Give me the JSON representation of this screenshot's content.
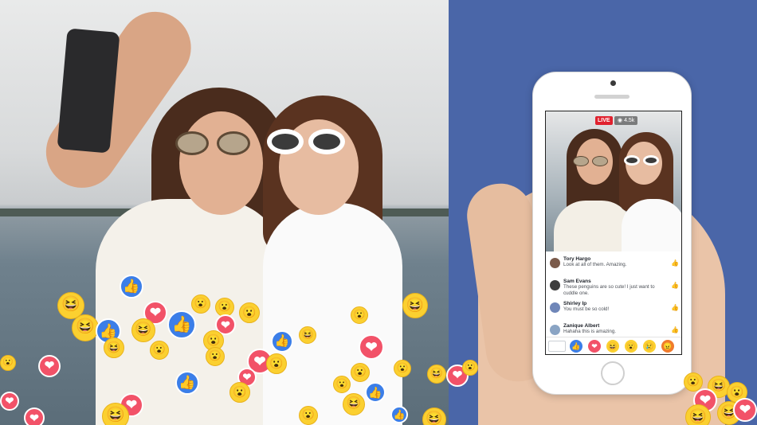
{
  "colors": {
    "brand_blue": "#4a66a8",
    "like_blue": "#3b7ee8",
    "love_red": "#f25268",
    "emoji_yellow": "#fbd030",
    "live_red": "#e0212e"
  },
  "live": {
    "badge": "LIVE",
    "viewer_icon": "eye-icon",
    "viewer_count": "4.5k"
  },
  "comments": [
    {
      "name": "Tory Hargo",
      "text": "Look at all of them. Amazing.",
      "avatar_color": "#7a5a4a"
    },
    {
      "name": "Sam Evans",
      "text": "These penguins are so cute! I just want to cuddle one.",
      "avatar_color": "#3d3d3d"
    },
    {
      "name": "Shirley Ip",
      "text": "You must be so cold!",
      "avatar_color": "#6f86b8"
    },
    {
      "name": "Zanique Albert",
      "text": "Hahaha this is amazing.",
      "avatar_color": "#8aa4c4"
    }
  ],
  "reactions_bar": [
    "like",
    "love",
    "haha",
    "wow",
    "sad",
    "angry"
  ],
  "icons": {
    "like": "thumbs-up-icon",
    "love": "heart-icon",
    "haha": "laughing-face-icon",
    "wow": "surprised-face-icon",
    "sad": "sad-face-icon",
    "angry": "angry-face-icon",
    "comment_like": "thumbs-up-outline-icon"
  }
}
